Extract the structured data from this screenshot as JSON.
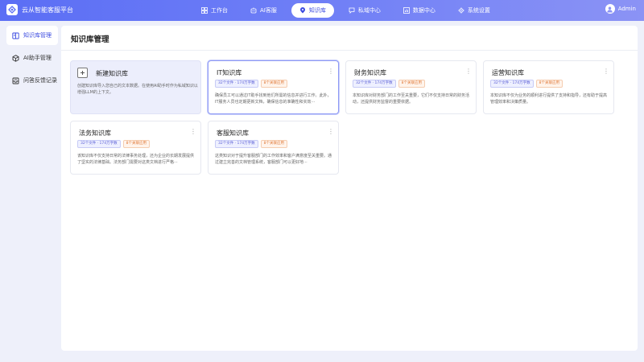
{
  "app": {
    "title": "云从智能客服平台"
  },
  "nav": [
    {
      "label": "工作台",
      "icon": "dashboard-icon"
    },
    {
      "label": "AI客服",
      "icon": "robot-icon"
    },
    {
      "label": "知识库",
      "icon": "location-icon",
      "active": true
    },
    {
      "label": "私域中心",
      "icon": "chat-icon"
    },
    {
      "label": "数据中心",
      "icon": "chart-icon"
    },
    {
      "label": "系统设置",
      "icon": "gear-icon"
    }
  ],
  "user": {
    "name": "Admin"
  },
  "sidebar": [
    {
      "label": "知识库管理",
      "icon": "book-icon",
      "active": true
    },
    {
      "label": "AI助手管理",
      "icon": "cube-icon"
    },
    {
      "label": "问答反馈记录",
      "icon": "inbox-icon"
    }
  ],
  "main": {
    "title": "知识库管理",
    "new_card": {
      "name": "新建知识库",
      "desc": "创建知识库导入您自己的文本数据。在使用AI助手时作为私域知识以增强LLM的上下文。"
    },
    "cards": [
      {
        "name": "IT知识库",
        "tag_files": "32个文件 · 174万字数",
        "tag_apps": "8个关联应用",
        "desc": "确保员工可以通过IT助手找到他们所需的信息并进行工作。此外，IT服务人员也定期更新文档，确保信息的准确性和实效···"
      },
      {
        "name": "财务知识库",
        "tag_files": "32个文件 · 174万字数",
        "tag_apps": "8个关联应用",
        "desc": "本知识库对财务部门的工作至关重要，它们不仅支持日常的财务活动，还提供财务监督的重要依据。"
      },
      {
        "name": "运营知识库",
        "tag_files": "32个文件 · 174万字数",
        "tag_apps": "8个关联应用",
        "desc": "本知识库不仅为业务的顺利进行提供了支持和指导，还有助于提高管理效率和决策质量。"
      },
      {
        "name": "法务知识库",
        "tag_files": "32个文件 · 174万字数",
        "tag_apps": "8个关联应用",
        "desc": "该知识库不仅支持日常的法律事务处理，还为企业的长期发展提供了坚实的法律基础。法务部门需要对这类文档进行严格···"
      },
      {
        "name": "客服知识库",
        "tag_files": "32个文件 · 174万字数",
        "tag_apps": "8个关联应用",
        "desc": "这类知识对于提升客服部门的工作效率和客户满意度至关重要。通过建立完善的文档管理系统，客服部门可以更好地···"
      }
    ]
  },
  "colors": {
    "accent": "#5b6ef5",
    "tag_purple": "#5b5fd6",
    "tag_orange": "#e07a3a"
  }
}
